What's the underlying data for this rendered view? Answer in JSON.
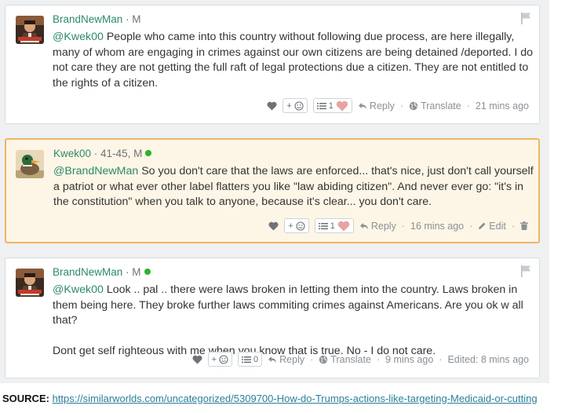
{
  "posts": [
    {
      "author": "BrandNewMan",
      "meta": "· M",
      "online": false,
      "mention": "@Kwek00",
      "paragraphs": [
        "People who came into this country without following due process, are here illegally, many of whom are engaging in crimes against our own citizens are being detained /deported. I do not care they are not getting the full raft of legal protections due a citizen. They are not entitled to the rights of a citizen."
      ],
      "react_label": "+",
      "list_count": "1",
      "reply": "Reply",
      "translate": "Translate",
      "time": "21 mins ago"
    },
    {
      "author": "Kwek00",
      "meta": "· 41-45, M",
      "online": true,
      "mention": "@BrandNewMan",
      "paragraphs": [
        "So you don't care that the laws are enforced... that's nice, just don't call yourself a patriot or what ever other label flatters you like \"law abiding citizen\". And never ever go: \"it's in the constitution\" when you talk to anyone, because it's clear... you don't care."
      ],
      "react_label": "+",
      "list_count": "1",
      "reply": "Reply",
      "time": "16 mins ago",
      "edit": "Edit"
    },
    {
      "author": "BrandNewMan",
      "meta": "· M",
      "online": true,
      "mention": "@Kwek00",
      "paragraphs": [
        "Look .. pal .. there were laws broken in letting them into the country. Laws broken in them being here. They broke further laws commiting crimes against Americans. Are you ok w all that?",
        "Dont get self righteous with me when you know that is true. No - I do not care."
      ],
      "react_label": "+",
      "list_count": "0",
      "reply": "Reply",
      "translate": "Translate",
      "time": "9 mins ago",
      "edited": "Edited: 8 mins ago"
    }
  ],
  "source": {
    "label": "SOURCE:",
    "url": "https://similarworlds.com/uncategorized/5309700-How-do-Trumps-actions-like-targeting-Medicaid-or-cutting"
  },
  "colors": {
    "author": "#2b8a6a",
    "highlight_border": "#f0b562",
    "highlight_bg": "#fdf6e6",
    "online": "#2cb32c"
  }
}
